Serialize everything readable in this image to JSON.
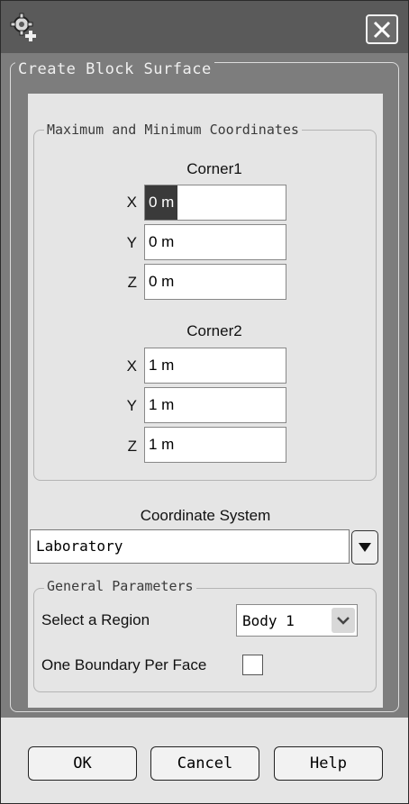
{
  "window": {
    "title": ""
  },
  "frame": {
    "title": "Create Block Surface"
  },
  "coords_group": {
    "title": "Maximum and Minimum Coordinates",
    "corner1": {
      "heading": "Corner1",
      "x_label": "X",
      "x_value": "0 m",
      "y_label": "Y",
      "y_value": "0 m",
      "z_label": "Z",
      "z_value": "0 m"
    },
    "corner2": {
      "heading": "Corner2",
      "x_label": "X",
      "x_value": "1 m",
      "y_label": "Y",
      "y_value": "1 m",
      "z_label": "Z",
      "z_value": "1 m"
    }
  },
  "coordinate_system": {
    "label": "Coordinate System",
    "value": "Laboratory"
  },
  "general_params": {
    "title": "General Parameters",
    "region_label": "Select a Region",
    "region_value": "Body 1",
    "boundary_label": "One Boundary Per Face",
    "boundary_checked": false
  },
  "buttons": {
    "ok": "OK",
    "cancel": "Cancel",
    "help": "Help"
  },
  "icons": {
    "app": "app-gear-icon",
    "close": "close-icon",
    "dropdown": "chevron-down-icon"
  },
  "colors": {
    "titlebar": "#5a5a5a",
    "frame": "#7d7d7d",
    "panel": "#e5e5e5",
    "selection": "#3a3a3a"
  }
}
